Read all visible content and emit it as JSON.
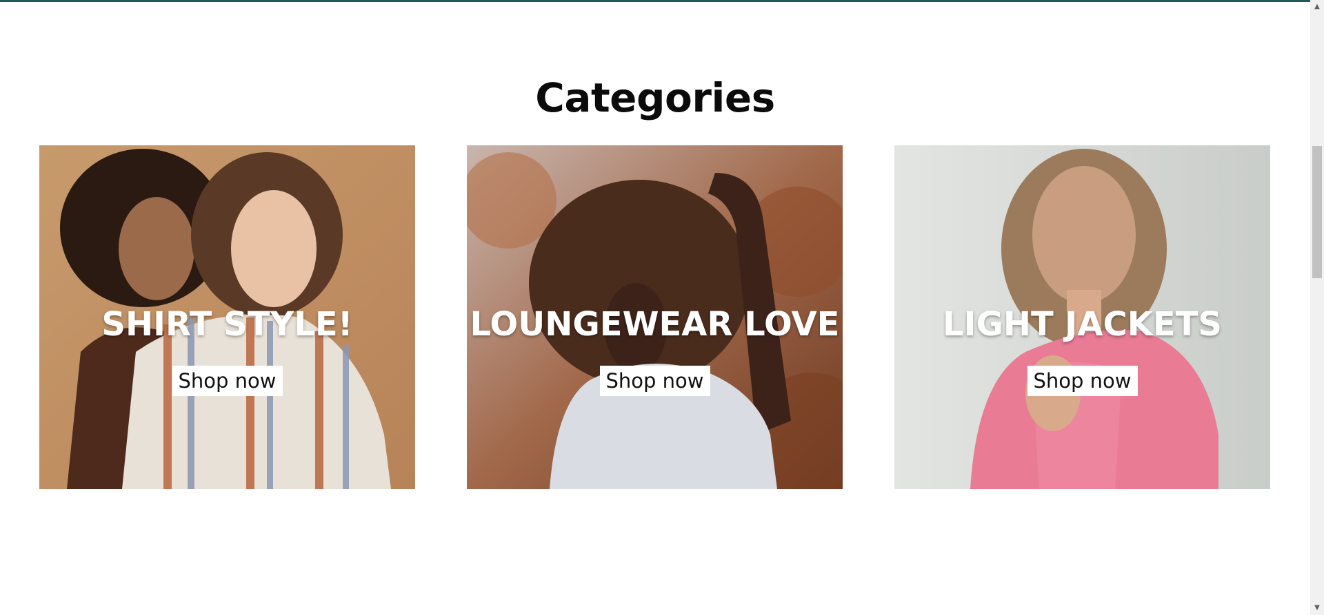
{
  "section": {
    "title": "Categories"
  },
  "categories": [
    {
      "title": "SHIRT STYLE!",
      "button_label": "Shop now",
      "image_icon": "two-women-striped-shirt-photo"
    },
    {
      "title": "LOUNGEWEAR LOVE",
      "button_label": "Shop now",
      "image_icon": "woman-afro-white-tee-photo"
    },
    {
      "title": "LIGHT JACKETS",
      "button_label": "Shop now",
      "image_icon": "woman-pink-jacket-photo"
    }
  ],
  "colors": {
    "top_accent": "#1f5b57",
    "text": "#0b0b0b",
    "button_bg": "#ffffff"
  },
  "scrollbar": {
    "up_icon": "scroll-up-arrow-icon",
    "down_icon": "scroll-down-arrow-icon"
  }
}
